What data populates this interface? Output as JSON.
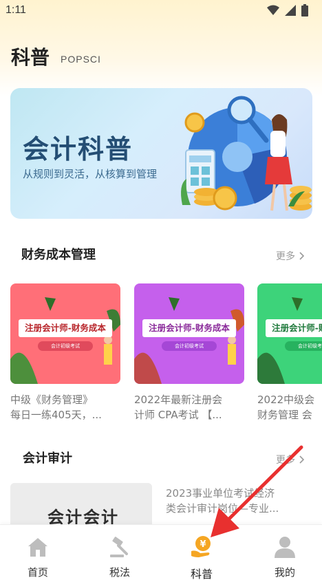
{
  "status": {
    "time": "1:11"
  },
  "header": {
    "title": "科普",
    "subtitle": "POPSCI"
  },
  "banner": {
    "title": "会计科普",
    "subtitle": "从规则到灵活，从核算到管理"
  },
  "section1": {
    "title": "财务成本管理",
    "more": "更多",
    "cards": [
      {
        "thumb_label": "注册会计师-财务成本",
        "thumb_pill": "会计初级考试",
        "caption_line1": "中级《财务管理》",
        "caption_line2": "每日一练405天，...",
        "color_bg": "#ff6f78",
        "color_pill": "#e04a5c"
      },
      {
        "thumb_label": "注册会计师-财务成本",
        "thumb_pill": "会计初级考试",
        "caption_line1": "2022年最新注册会",
        "caption_line2": "计师 CPA考试 【...",
        "color_bg": "#c560ec",
        "color_pill": "#a547d6"
      },
      {
        "thumb_label": "注册会计师-财务成本",
        "thumb_pill": "会计初级考试",
        "caption_line1": "2022中级会",
        "caption_line2": "财务管理 会",
        "color_bg": "#3dd37a",
        "color_pill": "#27b25f"
      }
    ]
  },
  "section2": {
    "title": "会计审计",
    "more": "更多",
    "article": {
      "thumb_text": "会计会计",
      "line1": "2023事业单位考试经济",
      "line2": "类会计审计岗位—专业..."
    }
  },
  "tabbar": {
    "tabs": [
      {
        "label": "首页",
        "icon": "home-icon"
      },
      {
        "label": "税法",
        "icon": "gavel-icon"
      },
      {
        "label": "科普",
        "icon": "yuan-hand-icon"
      },
      {
        "label": "我的",
        "icon": "user-icon"
      }
    ]
  },
  "colors": {
    "accent": "#f5a623",
    "banner_text": "#244e74"
  }
}
